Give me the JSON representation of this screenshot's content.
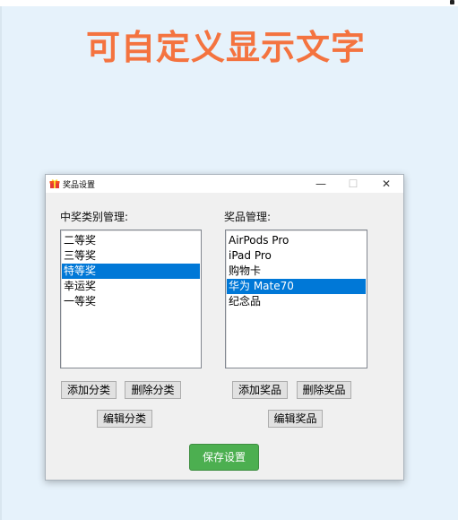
{
  "headline": "可自定义显示文字",
  "dialog": {
    "title": "奖品设置",
    "controls": {
      "minimize": "—",
      "maximize": "☐",
      "close": "✕"
    },
    "category_panel": {
      "label": "中奖类别管理:",
      "items": [
        "二等奖",
        "三等奖",
        "特等奖",
        "幸运奖",
        "一等奖"
      ],
      "selected_index": 2,
      "buttons": {
        "add": "添加分类",
        "delete": "删除分类",
        "edit": "编辑分类"
      }
    },
    "prize_panel": {
      "label": "奖品管理:",
      "items": [
        "AirPods Pro",
        "iPad Pro",
        "购物卡",
        "华为 Mate70",
        "纪念品"
      ],
      "selected_index": 3,
      "buttons": {
        "add": "添加奖品",
        "delete": "删除奖品",
        "edit": "编辑奖品"
      }
    },
    "save_label": "保存设置"
  },
  "colors": {
    "headline": "#f4733f",
    "selection": "#0078d7",
    "save_button": "#4caf50"
  }
}
